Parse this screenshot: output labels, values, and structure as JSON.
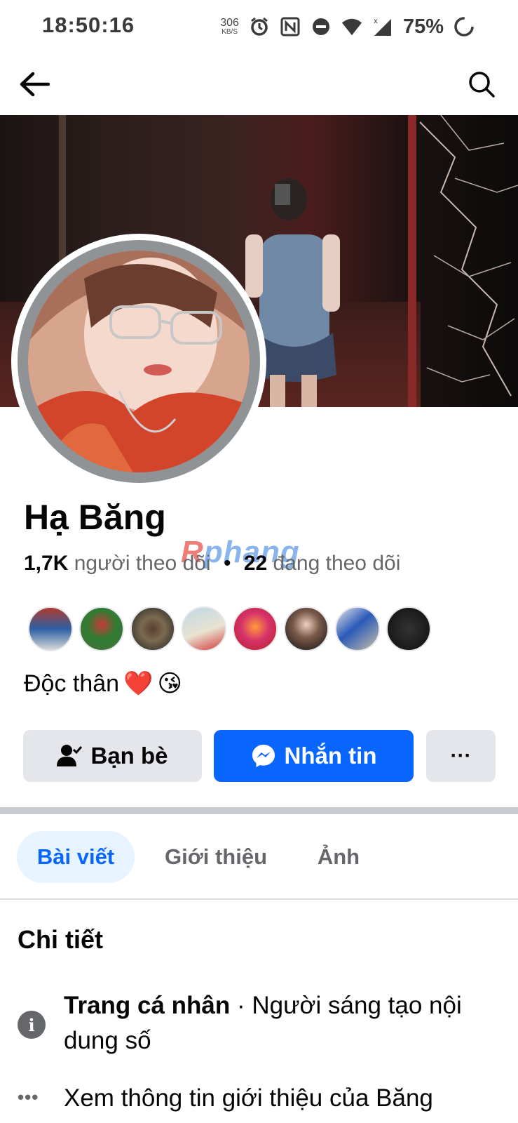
{
  "status_bar": {
    "time": "18:50:16",
    "net_speed_value": "306",
    "net_speed_unit": "KB/S",
    "battery": "75%",
    "icons": [
      "alarm-icon",
      "nfc-icon",
      "do-not-disturb-icon",
      "wifi-icon",
      "cell-signal-icon",
      "battery-icon"
    ]
  },
  "nav": {
    "back_icon": "arrow-left-icon",
    "search_icon": "search-icon"
  },
  "profile": {
    "name": "Hạ Băng",
    "watermark": "Rphang",
    "followers_count": "1,7K",
    "followers_label": "người theo dõi",
    "separator": "•",
    "following_count": "22",
    "following_label": "đang theo dõi",
    "bio_text": "Độc thân",
    "bio_emojis": [
      "❤️",
      "😘"
    ]
  },
  "friends_preview": [
    {
      "name": "friend-1"
    },
    {
      "name": "friend-2"
    },
    {
      "name": "friend-3"
    },
    {
      "name": "friend-4"
    },
    {
      "name": "friend-5"
    },
    {
      "name": "friend-6"
    },
    {
      "name": "friend-7"
    },
    {
      "name": "friend-8"
    }
  ],
  "actions": {
    "friends_label": "Bạn bè",
    "message_label": "Nhắn tin",
    "more_label": "···"
  },
  "tabs": [
    {
      "label": "Bài viết",
      "active": true
    },
    {
      "label": "Giới thiệu",
      "active": false
    },
    {
      "label": "Ảnh",
      "active": false
    }
  ],
  "details": {
    "title": "Chi tiết",
    "page_type_bold": "Trang cá nhân",
    "page_type_rest": " · Người sáng tạo nội dung số",
    "see_about": "Xem thông tin giới thiệu của Băng"
  },
  "colors": {
    "brand_blue": "#0866ff",
    "tab_active_bg": "#e7f3ff",
    "button_gray": "#e4e6eb",
    "secondary_text": "#65676b"
  }
}
